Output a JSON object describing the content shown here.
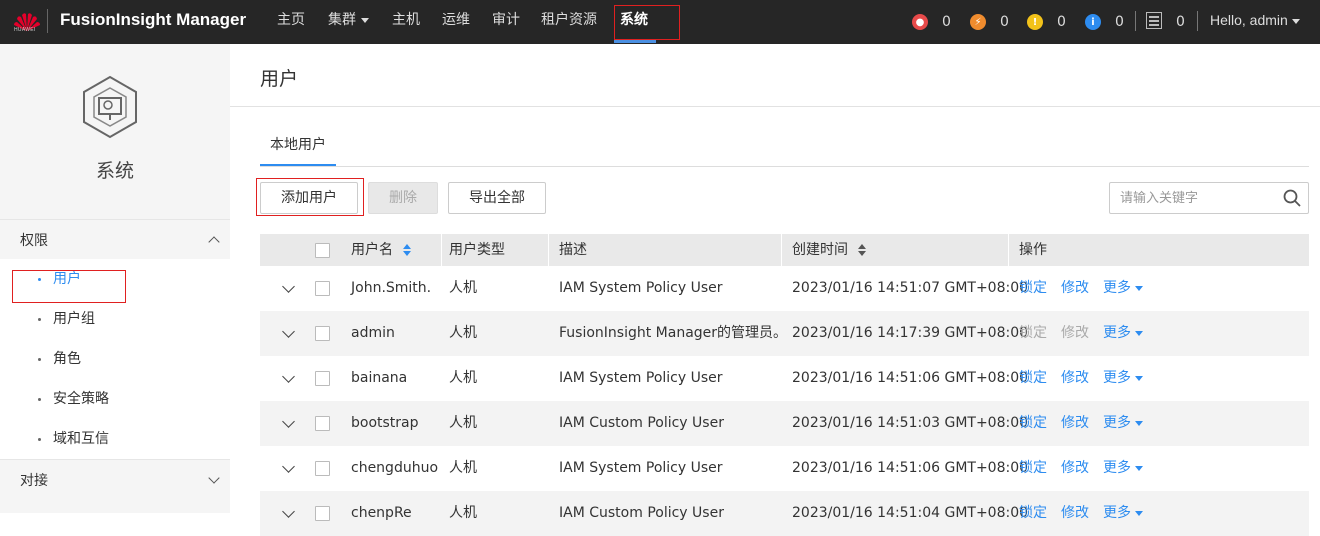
{
  "brand": {
    "logo_text": "HUAWEI",
    "app_title": "FusionInsight Manager"
  },
  "topnav": {
    "items": [
      "主页",
      "集群",
      "主机",
      "运维",
      "审计",
      "租户资源",
      "系统"
    ],
    "active": "系统"
  },
  "alarms": [
    {
      "icon": "critical-alarm-icon",
      "color": "#e84a4a",
      "count": "0"
    },
    {
      "icon": "major-alarm-icon",
      "color": "#f08c2e",
      "count": "0"
    },
    {
      "icon": "minor-alarm-icon",
      "color": "#f2c21a",
      "count": "0"
    },
    {
      "icon": "info-alarm-icon",
      "color": "#2d8cf0",
      "count": "0"
    }
  ],
  "tasks": {
    "count": "0"
  },
  "user_menu": {
    "label": "Hello, admin"
  },
  "sidebar": {
    "title": "系统",
    "sections": [
      {
        "label": "权限",
        "expanded": true,
        "items": [
          "用户",
          "用户组",
          "角色",
          "安全策略",
          "域和互信"
        ],
        "active": "用户"
      },
      {
        "label": "对接",
        "expanded": false
      }
    ]
  },
  "main": {
    "title": "用户",
    "tabs": [
      "本地用户"
    ],
    "buttons": {
      "add": "添加用户",
      "delete": "删除",
      "export": "导出全部"
    },
    "search_placeholder": "请输入关键字"
  },
  "table": {
    "columns": [
      "用户名",
      "用户类型",
      "描述",
      "创建时间",
      "操作"
    ],
    "rows": [
      {
        "name": "John.Smith.",
        "type": "人机",
        "desc": "IAM System Policy User",
        "created": "2023/01/16 14:51:07 GMT+08:00",
        "ops_enabled": true
      },
      {
        "name": "admin",
        "type": "人机",
        "desc": "FusionInsight Manager的管理员。",
        "created": "2023/01/16 14:17:39 GMT+08:00",
        "ops_enabled": false
      },
      {
        "name": "bainana",
        "type": "人机",
        "desc": "IAM System Policy User",
        "created": "2023/01/16 14:51:06 GMT+08:00",
        "ops_enabled": true
      },
      {
        "name": "bootstrap",
        "type": "人机",
        "desc": "IAM Custom Policy User",
        "created": "2023/01/16 14:51:03 GMT+08:00",
        "ops_enabled": true
      },
      {
        "name": "chengduhuo",
        "type": "人机",
        "desc": "IAM System Policy User",
        "created": "2023/01/16 14:51:06 GMT+08:00",
        "ops_enabled": true
      },
      {
        "name": "chenpRe",
        "type": "人机",
        "desc": "IAM Custom Policy User",
        "created": "2023/01/16 14:51:04 GMT+08:00",
        "ops_enabled": true
      }
    ],
    "ops": {
      "lock": "锁定",
      "modify": "修改",
      "more": "更多"
    }
  }
}
